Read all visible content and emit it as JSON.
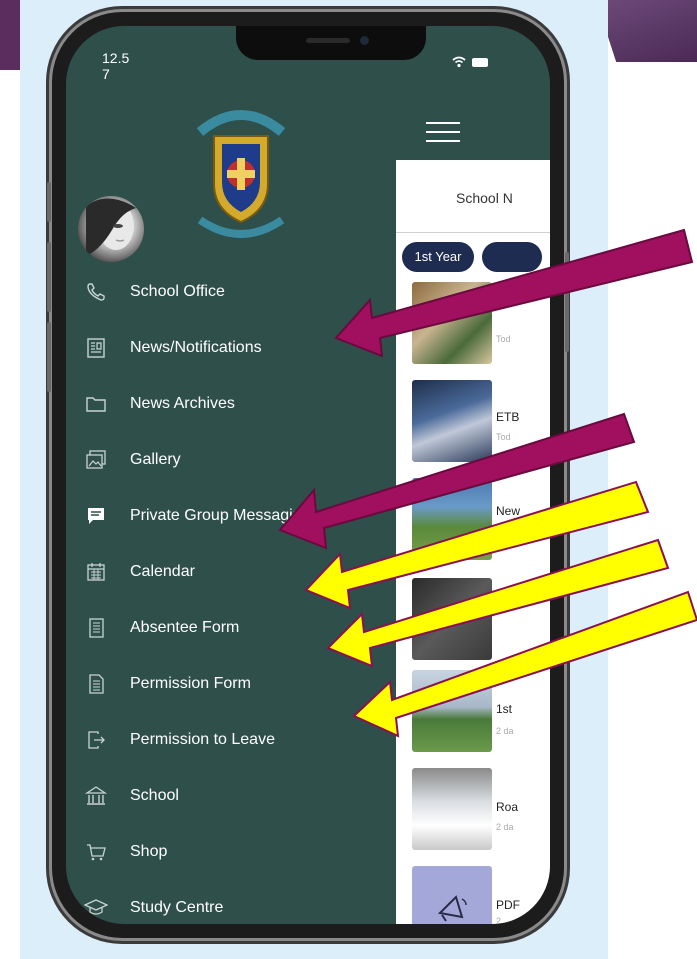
{
  "status": {
    "time": "12.5 7"
  },
  "drawer": {
    "items": [
      {
        "label": "School Office",
        "icon": "phone-icon"
      },
      {
        "label": "News/Notifications",
        "icon": "newspaper-icon"
      },
      {
        "label": "News Archives",
        "icon": "folder-icon"
      },
      {
        "label": "Gallery",
        "icon": "gallery-icon"
      },
      {
        "label": "Private Group Messaging",
        "icon": "chat-icon"
      },
      {
        "label": "Calendar",
        "icon": "calendar-icon"
      },
      {
        "label": "Absentee Form",
        "icon": "form-icon"
      },
      {
        "label": "Permission Form",
        "icon": "document-icon"
      },
      {
        "label": "Permission to Leave",
        "icon": "exit-icon"
      },
      {
        "label": "School",
        "icon": "building-icon"
      },
      {
        "label": "Shop",
        "icon": "cart-icon"
      },
      {
        "label": "Study Centre",
        "icon": "graduation-cap-icon"
      }
    ]
  },
  "content": {
    "title": "School N",
    "chips": [
      "1st Year",
      ""
    ],
    "rows": [
      {
        "title": "",
        "sub": "Tod"
      },
      {
        "title": "ETB",
        "sub": "Tod"
      },
      {
        "title": "New",
        "sub": "To"
      },
      {
        "title": "",
        "sub": ""
      },
      {
        "title": "1st",
        "sub": "2 da"
      },
      {
        "title": "Roa",
        "sub": "2 da"
      },
      {
        "title": "PDF",
        "sub": "2"
      }
    ]
  },
  "colors": {
    "drawer_bg": "#2f4f4b",
    "chip_bg": "#1f2c52",
    "arrow_magenta": "#a0105e",
    "arrow_yellow": "#ffff00",
    "panel_bg": "#dceefa"
  }
}
